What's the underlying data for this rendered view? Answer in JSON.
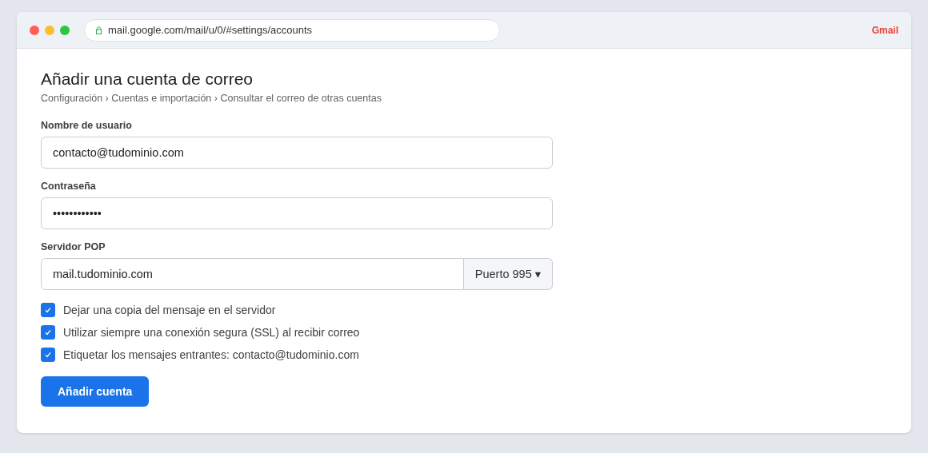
{
  "browser": {
    "url": "mail.google.com/mail/u/0/#settings/accounts",
    "brand": "Gmail"
  },
  "page": {
    "title": "Añadir una cuenta de correo",
    "breadcrumb": "Configuración › Cuentas e importación › Consultar el correo de otras cuentas"
  },
  "fields": [
    {
      "label": "Nombre de usuario",
      "value": "contacto@tudominio.com"
    },
    {
      "label": "Contraseña",
      "value": "••••••••••••"
    }
  ],
  "server": {
    "label": "Servidor POP",
    "value": "mail.tudominio.com",
    "port": "Puerto 995 ▾"
  },
  "options": [
    {
      "label": "Dejar una copia del mensaje en el servidor",
      "checked": true
    },
    {
      "label": "Utilizar siempre una conexión segura (SSL) al recibir correo",
      "checked": true
    },
    {
      "label": "Etiquetar los mensajes entrantes: contacto@tudominio.com",
      "checked": true
    }
  ],
  "submit": "Añadir cuenta"
}
